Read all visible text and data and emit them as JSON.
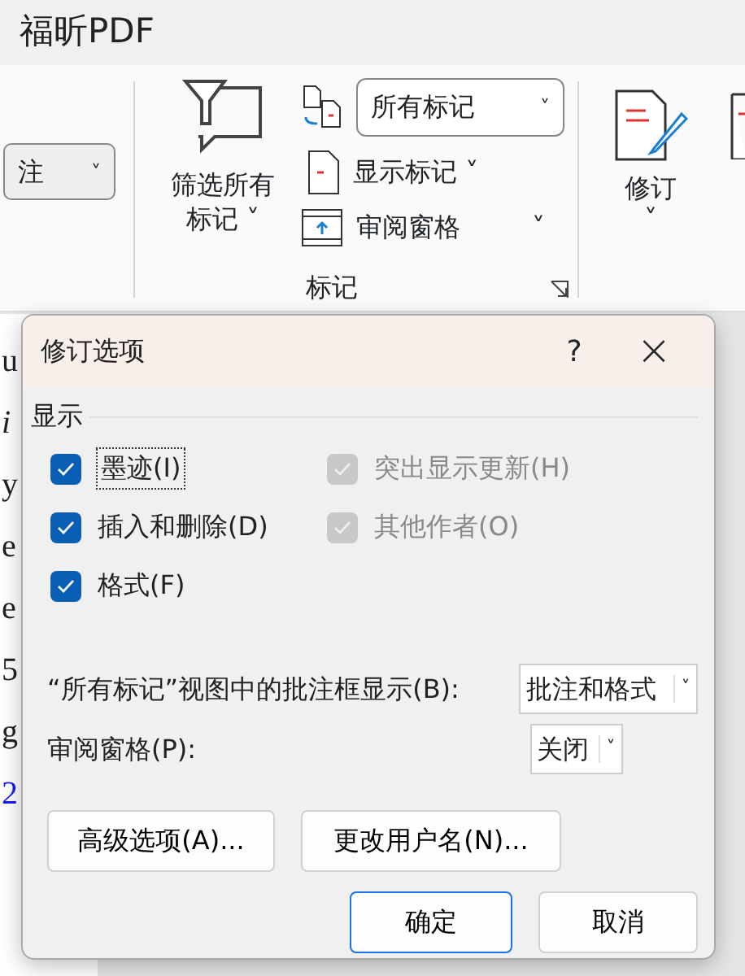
{
  "app_title": "福昕PDF",
  "ribbon": {
    "left_dropdown": {
      "value": "注",
      "caret": "˅"
    },
    "filter_button": {
      "label_line1": "筛选所有",
      "label_line2": "标记",
      "caret": "˅"
    },
    "markup_select": {
      "value": "所有标记",
      "caret": "˅"
    },
    "show_markup": {
      "label": "显示标记",
      "caret": "˅"
    },
    "review_pane": {
      "label": "审阅窗格",
      "caret": "˅"
    },
    "group_label": "标记",
    "track_button": {
      "label": "修订",
      "caret": "˅"
    }
  },
  "document_fragments": [
    {
      "text": "u",
      "link": false
    },
    {
      "text": "i",
      "link": false
    },
    {
      "text": "y",
      "link": false
    },
    {
      "text": "e",
      "link": false
    },
    {
      "text": "e",
      "link": false
    },
    {
      "text": "5",
      "link": false
    },
    {
      "text": "g",
      "link": false
    },
    {
      "text": "2",
      "link": true
    }
  ],
  "dialog": {
    "title": "修订选项",
    "help": "?",
    "close": "×",
    "section": "显示",
    "checkboxes": [
      {
        "label": "墨迹(I)",
        "checked": true,
        "disabled": false,
        "focused": true
      },
      {
        "label": "突出显示更新(H)",
        "checked": true,
        "disabled": true,
        "focused": false
      },
      {
        "label": "插入和删除(D)",
        "checked": true,
        "disabled": false,
        "focused": false
      },
      {
        "label": "其他作者(O)",
        "checked": true,
        "disabled": true,
        "focused": false
      },
      {
        "label": "格式(F)",
        "checked": true,
        "disabled": false,
        "focused": false
      }
    ],
    "selects": [
      {
        "label": "“所有标记”视图中的批注框显示(B):",
        "value": "批注和格式",
        "caret": "˅"
      },
      {
        "label": "审阅窗格(P):",
        "value": "关闭",
        "caret": "˅"
      }
    ],
    "option_buttons": [
      "高级选项(A)...",
      "更改用户名(N)..."
    ],
    "ok": "确定",
    "cancel": "取消"
  }
}
